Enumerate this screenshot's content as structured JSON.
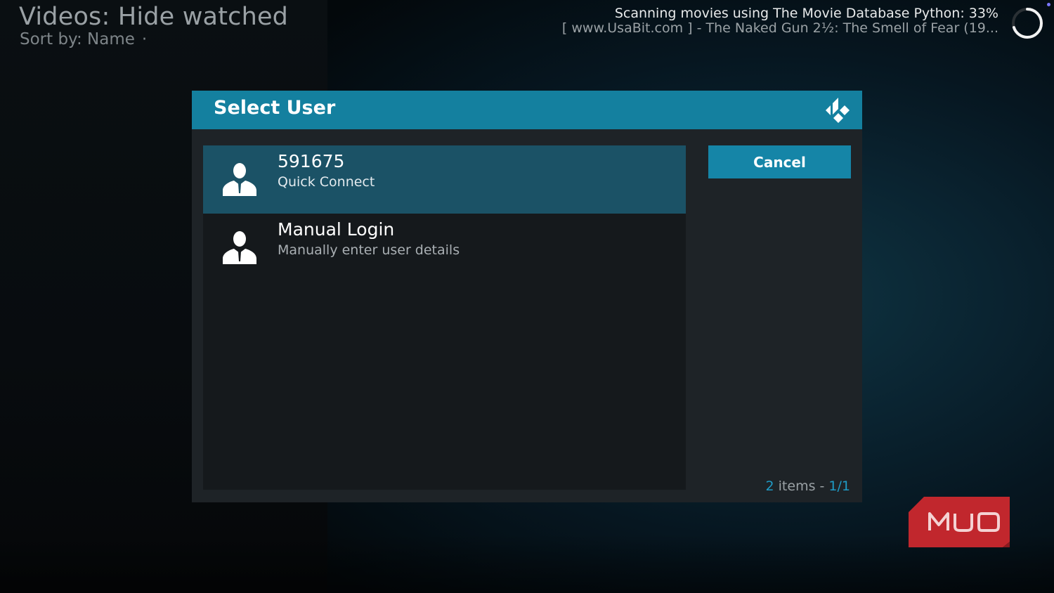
{
  "header": {
    "title": "Videos: Hide watched",
    "sort_label": "Sort by: Name",
    "sort_separator": "·"
  },
  "scan_status": {
    "line1": "Scanning movies using The Movie Database Python: 33%",
    "line2": "[ www.UsaBit.com ] - The Naked Gun 2½: The Smell of Fear (19...",
    "progress": 0.33
  },
  "dialog": {
    "title": "Select User",
    "logo_icon": "kodi-logo-icon",
    "users": [
      {
        "title": "591675",
        "subtitle": "Quick Connect",
        "icon": "user-icon",
        "selected": true
      },
      {
        "title": "Manual Login",
        "subtitle": "Manually enter user details",
        "icon": "user-icon",
        "selected": false
      }
    ],
    "cancel_label": "Cancel",
    "item_count": {
      "count": "2",
      "items_text": " items - ",
      "page": "1/1"
    }
  },
  "watermark": {
    "text": "MUO",
    "color": "#c1272d"
  },
  "colors": {
    "accent": "#14809f",
    "selected_row": "#1b5266",
    "button": "#1585a7",
    "dialog_bg": "#1e2327"
  }
}
